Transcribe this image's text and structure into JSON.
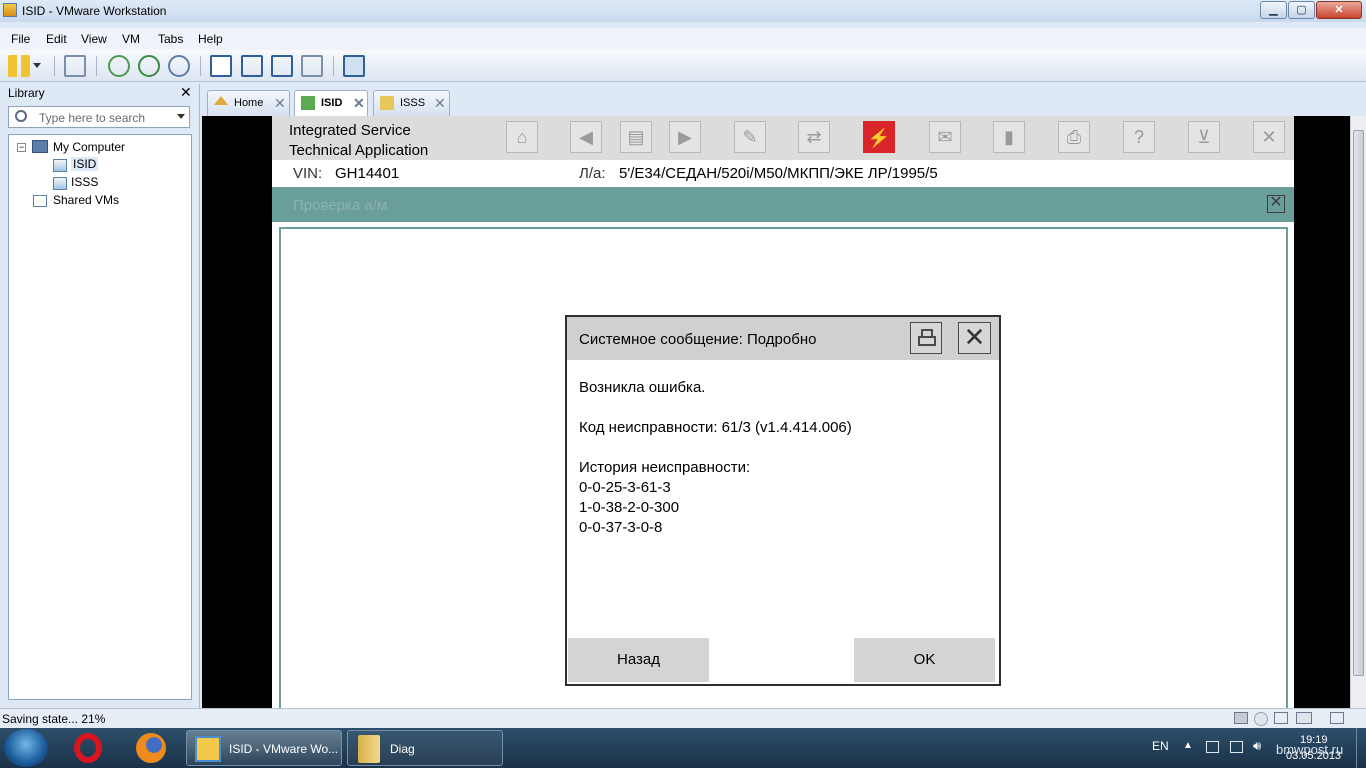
{
  "window": {
    "title": "ISID - VMware Workstation"
  },
  "menu": [
    "File",
    "Edit",
    "View",
    "VM",
    "Tabs",
    "Help"
  ],
  "library": {
    "title": "Library",
    "search_placeholder": "Type here to search",
    "tree": {
      "root": "My Computer",
      "vms": [
        "ISID",
        "ISSS"
      ],
      "shared": "Shared VMs"
    }
  },
  "tabs": [
    {
      "label": "Home",
      "active": false
    },
    {
      "label": "ISID",
      "active": true
    },
    {
      "label": "ISSS",
      "active": false
    }
  ],
  "guest": {
    "app_name_line1": "Integrated Service",
    "app_name_line2": "Technical Application",
    "vin_label": "VIN:",
    "vin_value": "GH14401",
    "vehicle_label": "Л/а:",
    "vehicle_value": "5'/E34/СЕДАН/520i/M50/МКПП/ЭКЕ ЛР/1995/5",
    "mode_title": "Проверка а/м",
    "toolbar_icons": [
      "home-icon",
      "back-icon",
      "documents-icon",
      "forward-icon",
      "wrench-icon",
      "transfer-icon",
      "connector-icon",
      "mail-icon",
      "battery-icon",
      "print-icon",
      "help-icon",
      "collapse-icon",
      "close-icon"
    ],
    "active_icon_color": "#d9242a"
  },
  "dialog": {
    "title": "Системное сообщение: Подробно",
    "message": "Возникла ошибка.",
    "fault_code": "Код неисправности: 61/3 (v1.4.414.006)",
    "history_title": "История неисправности:",
    "history": [
      "0-0-25-3-61-3",
      "1-0-38-2-0-300",
      "0-0-37-3-0-8"
    ],
    "back_button": "Назад",
    "ok_button": "OK"
  },
  "status": {
    "text": "Saving state... 21%",
    "progress_percent": 21
  },
  "taskbar": {
    "tasks": [
      "ISID - VMware Wo...",
      "Diag"
    ],
    "lang": "EN",
    "time": "19:19",
    "date": "03.05.2013",
    "watermark": "bmwpost.ru"
  }
}
